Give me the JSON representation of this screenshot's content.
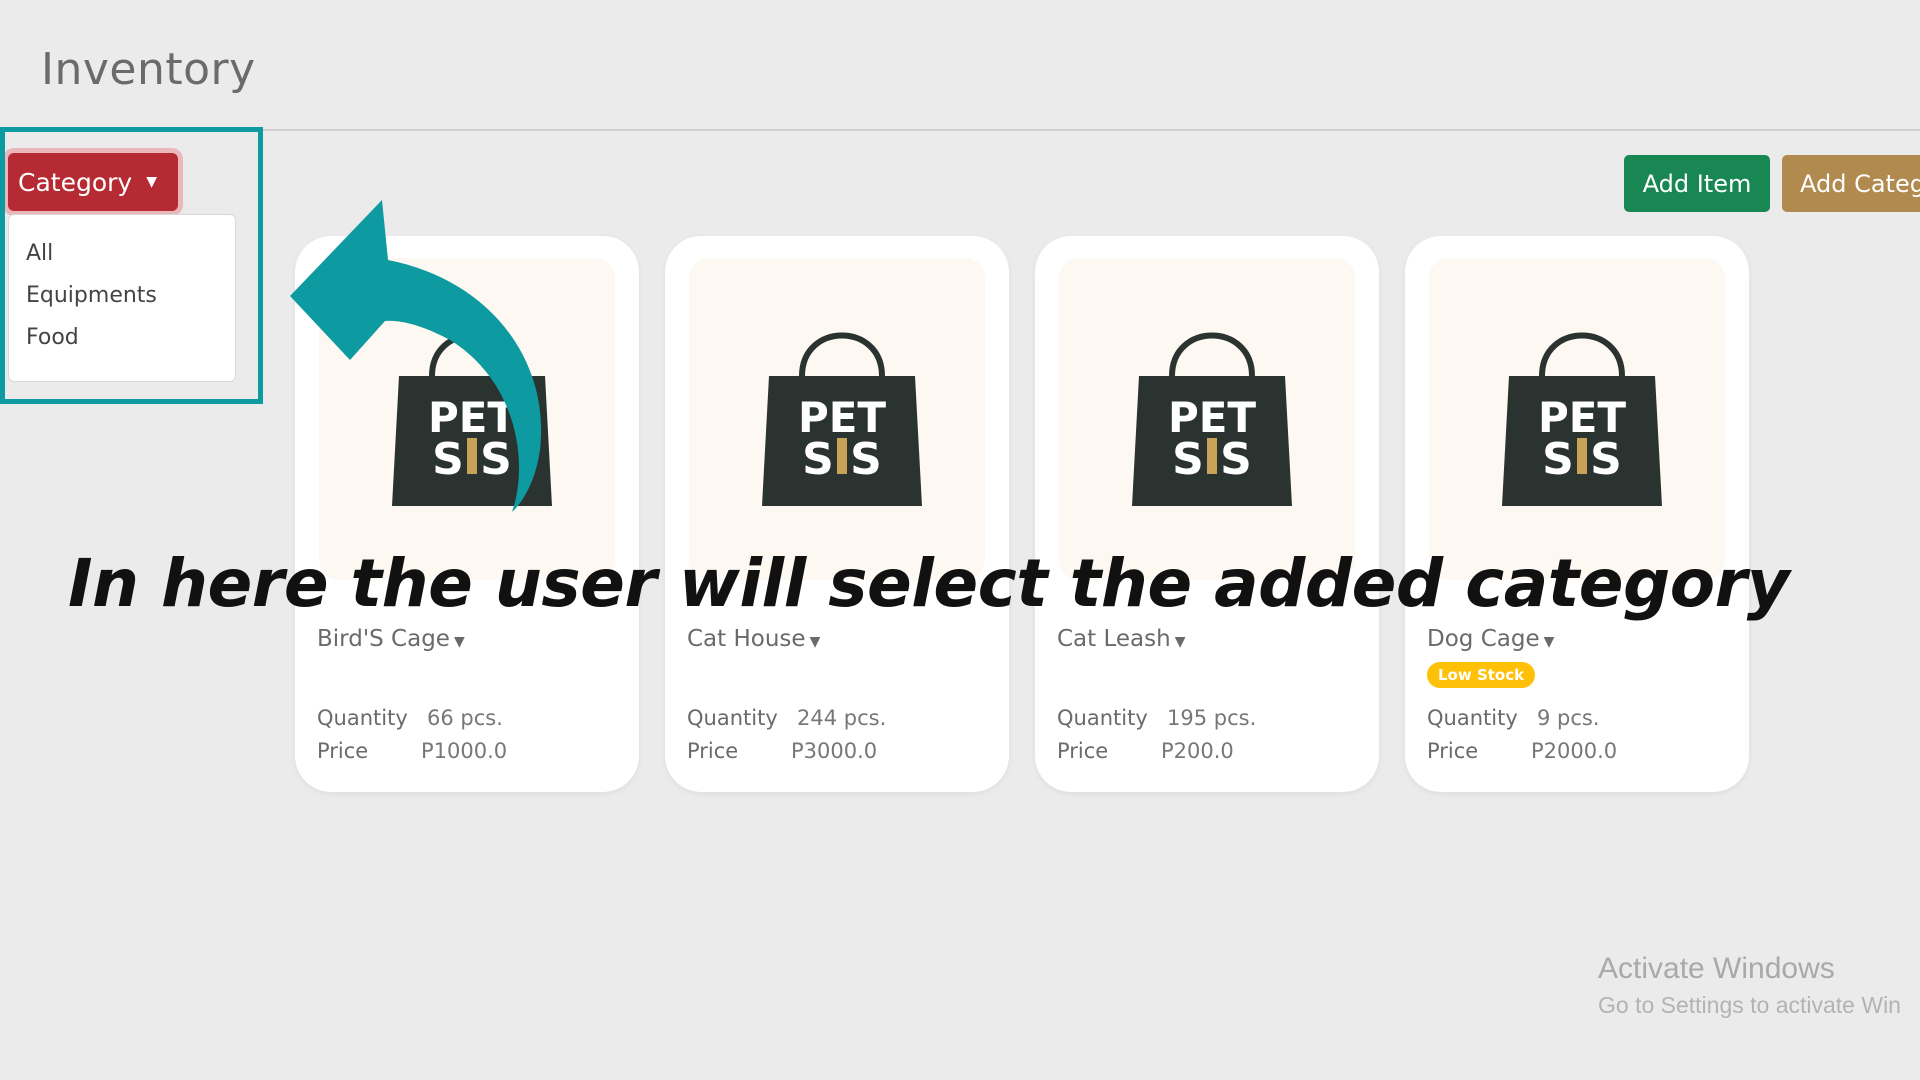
{
  "page": {
    "title": "Inventory"
  },
  "category_filter": {
    "button_label": "Category",
    "options": [
      "All",
      "Equipments",
      "Food"
    ]
  },
  "toolbar": {
    "add_item_label": "Add Item",
    "add_category_label": "Add Categ"
  },
  "items": [
    {
      "name": "Bird'S Cage",
      "quantity_label": "Quantity",
      "quantity": "66 pcs.",
      "price_label": "Price",
      "price": "P1000.0",
      "badge": ""
    },
    {
      "name": "Cat House",
      "quantity_label": "Quantity",
      "quantity": "244 pcs.",
      "price_label": "Price",
      "price": "P3000.0",
      "badge": ""
    },
    {
      "name": "Cat Leash",
      "quantity_label": "Quantity",
      "quantity": "195 pcs.",
      "price_label": "Price",
      "price": "P200.0",
      "badge": ""
    },
    {
      "name": "Dog Cage",
      "quantity_label": "Quantity",
      "quantity": "9 pcs.",
      "price_label": "Price",
      "price": "P2000.0",
      "badge": "Low Stock"
    }
  ],
  "logo": {
    "line1": "PET",
    "line2": "SIS"
  },
  "annotation": {
    "caption": "In here the user will select the added category"
  },
  "watermark": {
    "title": "Activate Windows",
    "subtitle": "Go to Settings to activate Win"
  },
  "colors": {
    "category_button": "#b52a33",
    "add_item": "#198754",
    "add_category": "#b08a4f",
    "highlight": "#0d9aa0",
    "low_stock": "#ffc107"
  }
}
